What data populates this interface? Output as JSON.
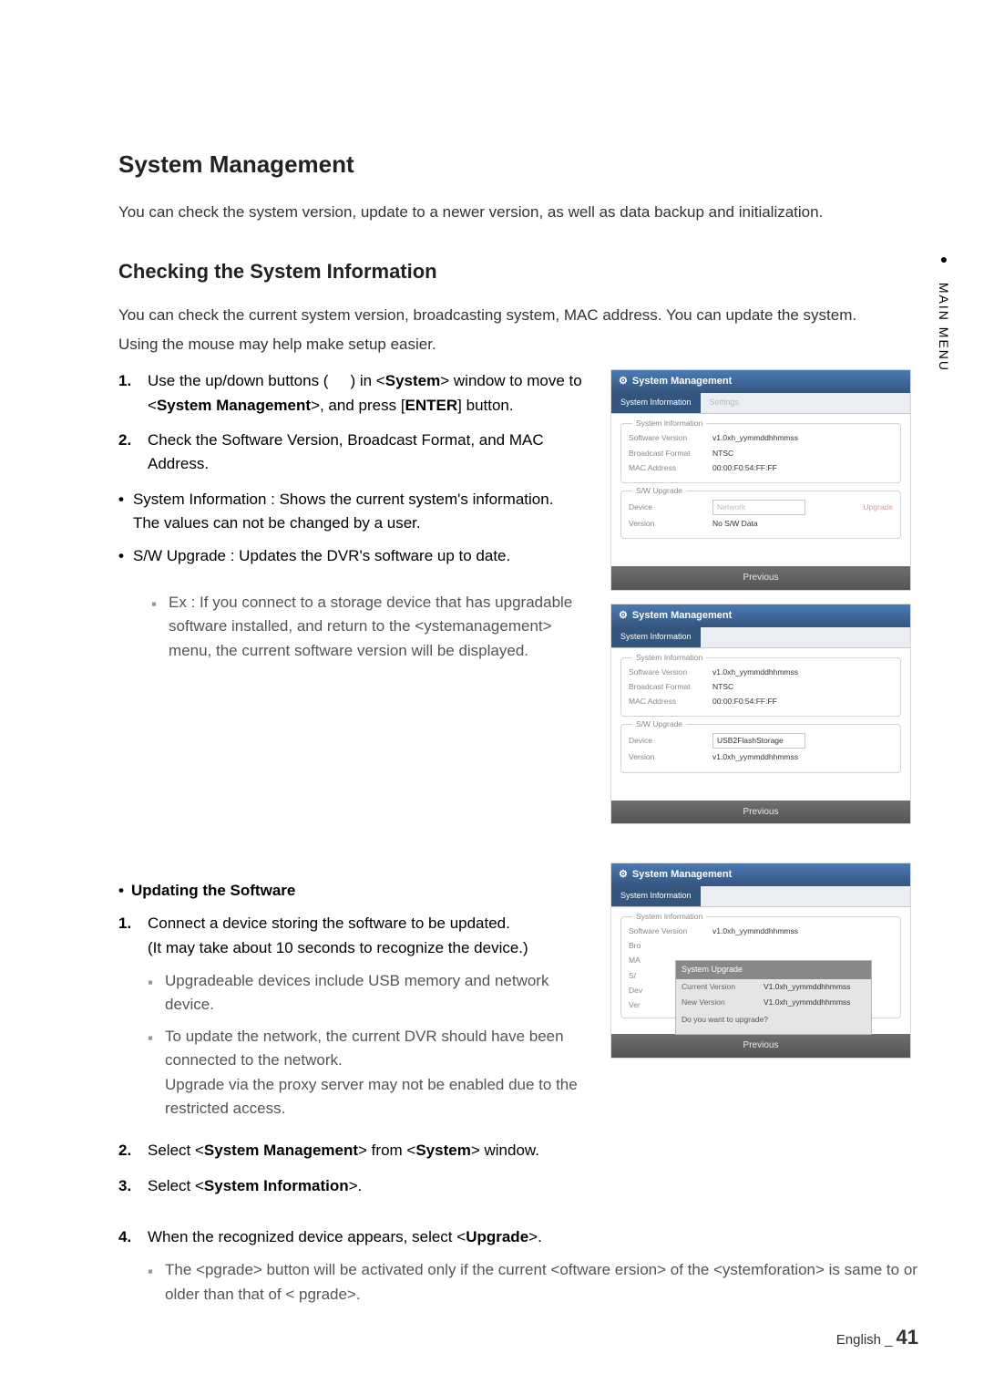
{
  "section_title": "System Management",
  "intro": "You can check the system version, update to a newer version, as well as data backup and initialization.",
  "subsection_title": "Checking the System Information",
  "subintro1": "You can check the current system version, broadcasting system, MAC address. You can update the system.",
  "subintro2": "Using the mouse may help make setup easier.",
  "steps_a": {
    "s1_pre": "Use the up/down buttons (",
    "s1_post": ") in <",
    "s1_bold1": "System",
    "s1_mid": "> window to move to <",
    "s1_bold2": "System Management",
    "s1_mid2": ">, and press [",
    "s1_bold3": "ENTER",
    "s1_end": "] button.",
    "s2": "Check the Software Version, Broadcast Format, and MAC Address."
  },
  "bullets_a": {
    "b1": "System Information : Shows the current system's information.",
    "b1b": "The values can not be changed by a user.",
    "b2": "S/W Upgrade : Updates the DVR's software up to date."
  },
  "ex_note": "Ex : If you connect to a storage device that has upgradable software installed, and return to the <ystemanagement> menu, the current software version will be displayed.",
  "updating_title": "Updating the Software",
  "steps_b": {
    "s1_a": "Connect a device storing the software to be updated.",
    "s1_b": "(It may take about 10 seconds to recognize the device.)",
    "s1_n1": "Upgradeable devices include USB memory and network device.",
    "s1_n2": "To update the network, the current DVR should have been connected to the network.",
    "s1_n2b": "Upgrade via the proxy server may not be enabled due to the restricted access.",
    "s2_pre": "Select <",
    "s2_bold1": "System Management",
    "s2_mid": "> from <",
    "s2_bold2": "System",
    "s2_end": "> window.",
    "s3_pre": "Select <",
    "s3_bold": "System Information",
    "s3_end": ">.",
    "s4_pre": "When the recognized device appears, select <",
    "s4_bold": "Upgrade",
    "s4_end": ">.",
    "s4_n1_a": "The <pgrade> button will be activated only if the current <oftware ersion> of the <ystemforation> is same to or older than that of < pgrade>."
  },
  "shot_common": {
    "title": "System Management",
    "tab_active": "System Information",
    "tab_inactive": "Settings",
    "g1": "System Information",
    "g1_l1": "Software Version",
    "g1_v1": "v1.0xh_yymmddhhmmss",
    "g1_l2": "Broadcast Format",
    "g1_v2": "NTSC",
    "g1_l3": "MAC Address",
    "g1_v3": "00:00:F0:54:FF:FF",
    "g2": "S/W Upgrade",
    "g2_l1": "Device",
    "g2_l2": "Version",
    "prev": "Previous"
  },
  "shot1": {
    "device": "Network",
    "version": "No S/W Data",
    "upgrade": "Upgrade"
  },
  "shot2": {
    "device": "USB2FlashStorage",
    "version": "v1.0xh_yymmddhhmmss"
  },
  "shot3": {
    "dialog_title": "System Upgrade",
    "cur_l": "Current Version",
    "cur_v": "V1.0xh_yymmddhhmmss",
    "new_l": "New Version",
    "new_v": "V1.0xh_yymmddhhmmss",
    "msg": "Do you want to upgrade?",
    "truncated_labels": [
      "Bro",
      "MA",
      "S/",
      "Dev",
      "Ver"
    ]
  },
  "sidetab": "MAIN MENU",
  "footer_lang": "English",
  "footer_page": "41"
}
